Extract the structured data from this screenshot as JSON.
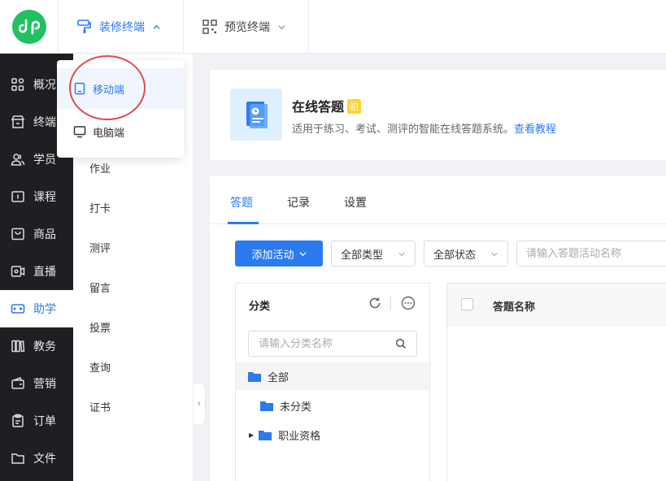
{
  "header": {
    "decor_label": "装修终端",
    "preview_label": "预览终端"
  },
  "sidebar": {
    "items": [
      {
        "label": "概况",
        "icon": "grid-icon"
      },
      {
        "label": "终端",
        "icon": "store-icon"
      },
      {
        "label": "学员",
        "icon": "users-icon"
      },
      {
        "label": "课程",
        "icon": "course-icon"
      },
      {
        "label": "商品",
        "icon": "bag-icon"
      },
      {
        "label": "直播",
        "icon": "live-icon"
      },
      {
        "label": "助学",
        "icon": "gamepad-icon"
      },
      {
        "label": "教务",
        "icon": "books-icon"
      },
      {
        "label": "营销",
        "icon": "wallet-icon"
      },
      {
        "label": "订单",
        "icon": "clipboard-icon"
      },
      {
        "label": "文件",
        "icon": "folder-icon"
      }
    ],
    "active_index": 6
  },
  "subnav": {
    "items": [
      "作业",
      "打卡",
      "测评",
      "留言",
      "投票",
      "查询",
      "证书"
    ]
  },
  "dropdown": {
    "mobile_label": "移动端",
    "pc_label": "电脑端"
  },
  "app": {
    "title": "在线答题",
    "badge": "初",
    "description": "适用于练习、考试、测评的智能在线答题系统。",
    "tutorial_link": "查看教程"
  },
  "tabs": [
    "答题",
    "记录",
    "设置"
  ],
  "toolbar": {
    "add_label": "添加活动",
    "type_select": "全部类型",
    "status_select": "全部状态",
    "search_placeholder": "请输入答题活动名称"
  },
  "category": {
    "title": "分类",
    "search_placeholder": "请输入分类名称",
    "tree": [
      "全部",
      "未分类",
      "职业资格"
    ]
  },
  "table": {
    "columns": [
      "答题名称"
    ]
  },
  "colors": {
    "accent": "#2b7bef",
    "sidebar_bg": "#1f1f23",
    "logo_green": "#21c161",
    "highlight_circle": "#e24a4a"
  }
}
